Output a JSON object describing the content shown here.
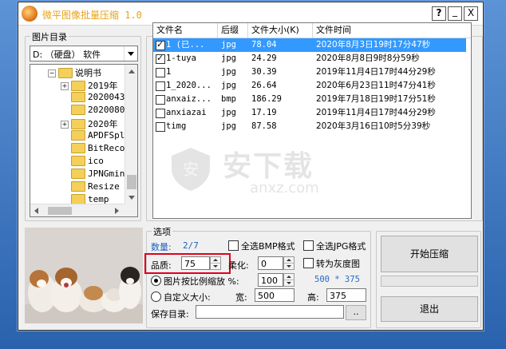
{
  "app": {
    "title": "微平图像批量压缩 1.0",
    "help_button": "?",
    "minimize_button": "_",
    "close_button": "X"
  },
  "folder_panel": {
    "group_label": "图片目录",
    "drive_combo": "D: （硬盘） 软件",
    "tree": [
      {
        "label": "说明书",
        "expander": "−",
        "depth": 0
      },
      {
        "label": "2019年",
        "expander": "+",
        "depth": 1
      },
      {
        "label": "2020043",
        "expander": "",
        "depth": 1
      },
      {
        "label": "2020080",
        "expander": "",
        "depth": 1
      },
      {
        "label": "2020年",
        "expander": "+",
        "depth": 1
      },
      {
        "label": "APDFSpl",
        "expander": "",
        "depth": 1
      },
      {
        "label": "BitReco",
        "expander": "",
        "depth": 1
      },
      {
        "label": "ico",
        "expander": "",
        "depth": 1
      },
      {
        "label": "JPNGmin",
        "expander": "",
        "depth": 1
      },
      {
        "label": "Resize",
        "expander": "",
        "depth": 1
      },
      {
        "label": "temp",
        "expander": "",
        "depth": 1
      }
    ]
  },
  "file_list": {
    "columns": [
      "文件名",
      "后缀",
      "文件大小(K)",
      "文件时间"
    ],
    "rows": [
      {
        "checked": true,
        "name": "1 (已...",
        "ext": "jpg",
        "size": "78.04",
        "time": "2020年8月3日19时17分47秒",
        "selected": true
      },
      {
        "checked": true,
        "name": "1-tuya",
        "ext": "jpg",
        "size": "24.29",
        "time": "2020年8月8日9时8分59秒",
        "selected": false
      },
      {
        "checked": false,
        "name": "1",
        "ext": "jpg",
        "size": "30.39",
        "time": "2019年11月4日17时44分29秒",
        "selected": false
      },
      {
        "checked": false,
        "name": "1_2020...",
        "ext": "jpg",
        "size": "26.64",
        "time": "2020年6月23日11时47分41秒",
        "selected": false
      },
      {
        "checked": false,
        "name": "anxaiz...",
        "ext": "bmp",
        "size": "186.29",
        "time": "2019年7月18日19时17分51秒",
        "selected": false
      },
      {
        "checked": false,
        "name": "anxiazai",
        "ext": "jpg",
        "size": "17.19",
        "time": "2019年11月4日17时44分29秒",
        "selected": false
      },
      {
        "checked": false,
        "name": "timg",
        "ext": "jpg",
        "size": "87.58",
        "time": "2020年3月16日10时5分39秒",
        "selected": false
      }
    ]
  },
  "options": {
    "group_label": "选项",
    "count_label": "数量:",
    "count_value": "2/7",
    "all_bmp_label": "全选BMP格式",
    "all_jpg_label": "全选JPG格式",
    "quality_label": "品质:",
    "quality_value": "75",
    "sharpen_label": "柔化:",
    "sharpen_value": "0",
    "grayscale_label": "转为灰度图",
    "scale_radio_label": "图片按比例缩放 %:",
    "scale_value": "100",
    "dimensions_text": "500 * 375",
    "custom_radio_label": "自定义大小:",
    "width_label": "宽:",
    "width_value": "500",
    "height_label": "高:",
    "height_value": "375",
    "save_dir_label": "保存目录:",
    "save_dir_value": "",
    "browse_button": ".."
  },
  "actions": {
    "start_button": "开始压缩",
    "exit_button": "退出"
  },
  "watermark": {
    "brand": "安下载",
    "domain": "anxz.com"
  },
  "colors": {
    "title": "#e8a317",
    "selection": "#3399ff",
    "count_value": "#1f5fbf",
    "dimensions": "#2a6cc7",
    "highlight_box": "#e0001b"
  }
}
